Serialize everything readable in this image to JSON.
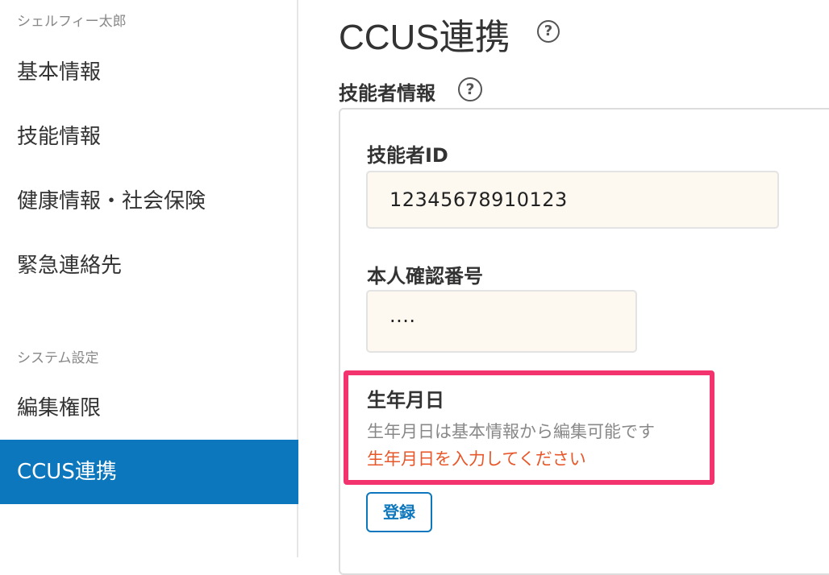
{
  "sidebar": {
    "user_section_label": "シェルフィー太郎",
    "items": [
      {
        "label": "基本情報"
      },
      {
        "label": "技能情報"
      },
      {
        "label": "健康情報・社会保険"
      },
      {
        "label": "緊急連絡先"
      }
    ],
    "system_section_label": "システム設定",
    "system_items": [
      {
        "label": "編集権限"
      },
      {
        "label": "CCUS連携",
        "active": true
      }
    ]
  },
  "main": {
    "title": "CCUS連携",
    "help_icon": "question-circle-icon",
    "section_title": "技能者情報",
    "form": {
      "technician_id_label": "技能者ID",
      "technician_id_value": "12345678910123",
      "verification_label": "本人確認番号",
      "verification_value": "····",
      "birthday_label": "生年月日",
      "birthday_hint": "生年月日は基本情報から編集可能です",
      "birthday_error": "生年月日を入力してください",
      "submit_label": "登録"
    }
  },
  "colors": {
    "accent": "#0c77bd",
    "highlight": "#f2336e",
    "error": "#e8572a",
    "input_bg": "#fdf8f0"
  }
}
